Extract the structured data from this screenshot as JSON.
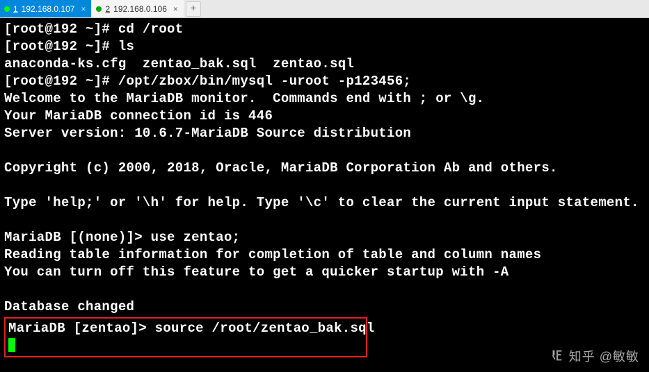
{
  "tabs": {
    "active": {
      "index": "1",
      "label": "192.168.0.107",
      "close": "×"
    },
    "inactive": {
      "index": "2",
      "label": "192.168.0.106",
      "close": "×"
    },
    "add": "+"
  },
  "term": {
    "l1": "[root@192 ~]# cd /root",
    "l2": "[root@192 ~]# ls",
    "l3": "anaconda-ks.cfg  zentao_bak.sql  zentao.sql",
    "l4": "[root@192 ~]# /opt/zbox/bin/mysql -uroot -p123456;",
    "l5": "Welcome to the MariaDB monitor.  Commands end with ; or \\g.",
    "l6": "Your MariaDB connection id is 446",
    "l7": "Server version: 10.6.7-MariaDB Source distribution",
    "l8": " ",
    "l9": "Copyright (c) 2000, 2018, Oracle, MariaDB Corporation Ab and others.",
    "l10": " ",
    "l11": "Type 'help;' or '\\h' for help. Type '\\c' to clear the current input statement.",
    "l12": " ",
    "l13": "MariaDB [(none)]> use zentao;",
    "l14": "Reading table information for completion of table and column names",
    "l15": "You can turn off this feature to get a quicker startup with -A",
    "l16": " ",
    "l17": "Database changed",
    "l18": "MariaDB [zentao]> source /root/zentao_bak.sql"
  },
  "watermark": {
    "text": "知乎 @敏敏"
  }
}
